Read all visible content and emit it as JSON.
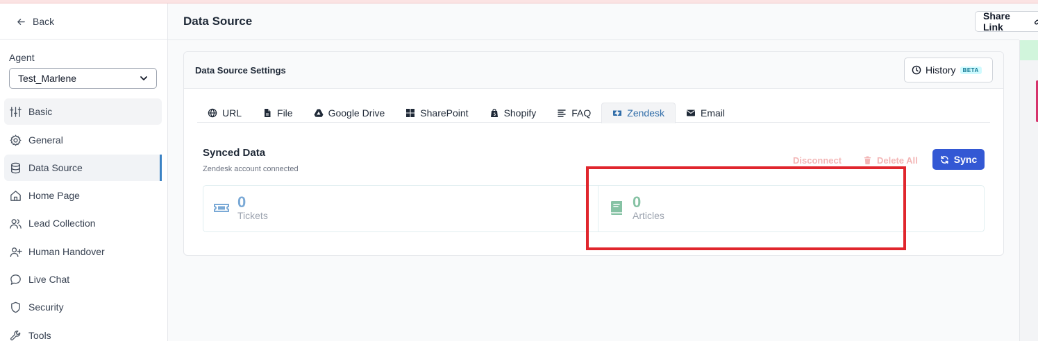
{
  "sidebar": {
    "back_label": "Back",
    "agent_label": "Agent",
    "agent_value": "Test_Marlene",
    "items": [
      {
        "label": "Basic",
        "icon": "sliders-icon"
      },
      {
        "label": "General",
        "icon": "gear-icon"
      },
      {
        "label": "Data Source",
        "icon": "database-icon"
      },
      {
        "label": "Home Page",
        "icon": "home-icon"
      },
      {
        "label": "Lead Collection",
        "icon": "users-icon"
      },
      {
        "label": "Human Handover",
        "icon": "user-plus-icon"
      },
      {
        "label": "Live Chat",
        "icon": "chat-bubble-icon"
      },
      {
        "label": "Security",
        "icon": "shield-icon"
      },
      {
        "label": "Tools",
        "icon": "wrench-icon"
      }
    ],
    "active_item": "Data Source"
  },
  "header": {
    "title": "Data Source",
    "share_label": "Share Link"
  },
  "card": {
    "title": "Data Source Settings",
    "history_label": "History",
    "history_badge": "BETA"
  },
  "tabs": [
    {
      "label": "URL",
      "icon": "globe-icon"
    },
    {
      "label": "File",
      "icon": "file-icon"
    },
    {
      "label": "Google Drive",
      "icon": "google-drive-icon"
    },
    {
      "label": "SharePoint",
      "icon": "sharepoint-icon"
    },
    {
      "label": "Shopify",
      "icon": "shopify-icon"
    },
    {
      "label": "FAQ",
      "icon": "faq-icon"
    },
    {
      "label": "Zendesk",
      "icon": "zendesk-icon"
    },
    {
      "label": "Email",
      "icon": "envelope-icon"
    }
  ],
  "active_tab": "Zendesk",
  "synced": {
    "title": "Synced Data",
    "subtitle": "Zendesk account connected",
    "disconnect_label": "Disconnect",
    "delete_all_label": "Delete All",
    "sync_label": "Sync"
  },
  "stats": [
    {
      "value": "0",
      "label": "Tickets",
      "icon": "ticket-icon",
      "color": "#7aa9d6"
    },
    {
      "value": "0",
      "label": "Articles",
      "icon": "book-icon",
      "color": "#86c2a4"
    }
  ],
  "colors": {
    "primary": "#3358d4",
    "active_tab_text": "#2f6ca8",
    "danger_muted": "#f3b6b6",
    "highlight_box": "#e0262d"
  }
}
